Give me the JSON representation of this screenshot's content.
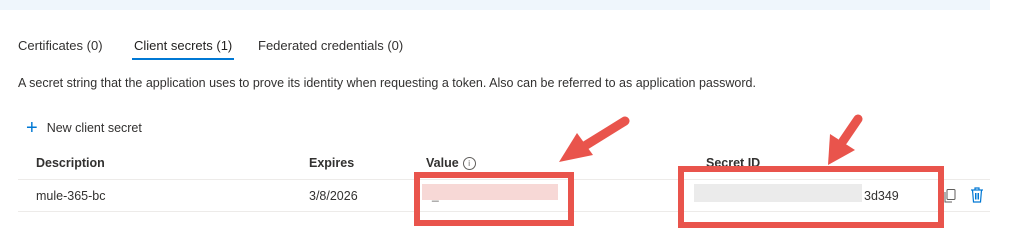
{
  "tabs": [
    {
      "label": "Certificates (0)"
    },
    {
      "label": "Client secrets (1)"
    },
    {
      "label": "Federated credentials (0)"
    }
  ],
  "description": "A secret string that the application uses to prove its identity when requesting a token. Also can be referred to as application password.",
  "new_secret_label": "New client secret",
  "table": {
    "headers": [
      "Description",
      "Expires",
      "Value",
      "Secret ID"
    ],
    "rows": [
      {
        "description": "mule-365-bc",
        "expires": "3/8/2026",
        "value_visible": "_",
        "secret_id_suffix": "3d349"
      }
    ]
  },
  "colors": {
    "accent": "#0078d4",
    "annotation": "#e9544c"
  }
}
